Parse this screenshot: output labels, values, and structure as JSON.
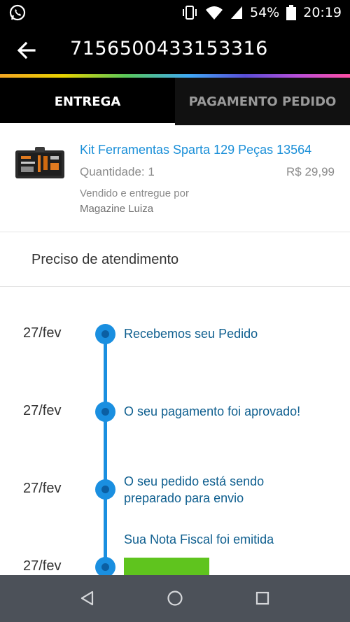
{
  "status_bar": {
    "battery": "54%",
    "time": "20:19",
    "icons": [
      "whatsapp-icon",
      "vibrate-icon",
      "wifi-icon",
      "signal-icon",
      "battery-icon"
    ]
  },
  "app_bar": {
    "title": "7156500433153316",
    "back_icon": "arrow-left-icon"
  },
  "tabs": [
    {
      "label": "ENTREGA",
      "active": true
    },
    {
      "label": "PAGAMENTO PEDIDO",
      "active": false
    }
  ],
  "product": {
    "name": "Kit Ferramentas Sparta 129 Peças 13564",
    "quantity": "Quantidade: 1",
    "price": "R$ 29,99",
    "seller_label": "Vendido e entregue por",
    "seller_name": "Magazine Luiza"
  },
  "help": {
    "label": "Preciso de atendimento"
  },
  "timeline": [
    {
      "date": "27/fev",
      "text": "Recebemos seu Pedido"
    },
    {
      "date": "27/fev",
      "text": "O seu pagamento foi aprovado!"
    },
    {
      "date": "27/fev",
      "text": "O seu pedido está sendo preparado para envio"
    },
    {
      "date": "27/fev",
      "text": "Sua Nota Fiscal foi emitida"
    }
  ],
  "colors": {
    "accent": "#1a8fe0",
    "link": "#1a8fd8",
    "success": "#5fc41e",
    "nav_bar": "#4c5159"
  },
  "nav_bar": {
    "icons": [
      "back-triangle-icon",
      "home-circle-icon",
      "recents-square-icon"
    ]
  }
}
